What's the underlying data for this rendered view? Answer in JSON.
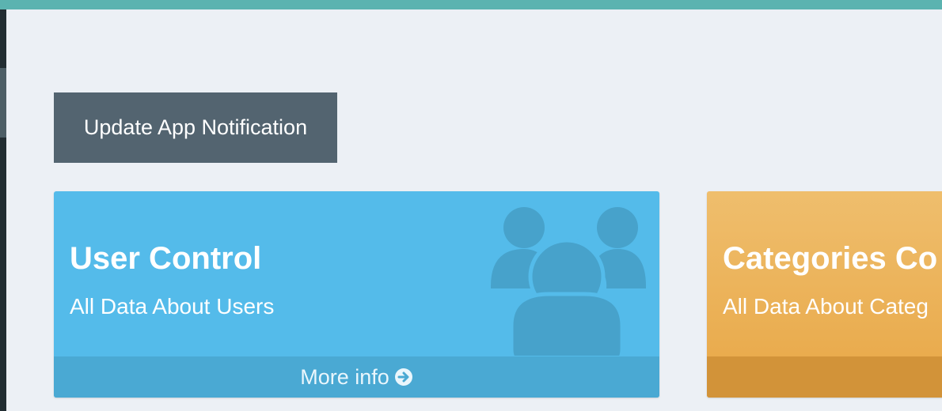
{
  "notification_button": {
    "label": "Update App Notification"
  },
  "cards": [
    {
      "title": "User Control",
      "subtitle": "All Data About Users",
      "footer_label": "More info",
      "footer_icon": "arrow-circle-right-icon",
      "background_icon": "users-icon",
      "color": "#54bbea"
    },
    {
      "title": "Categories Co",
      "subtitle": "All Data About Categ",
      "footer_label": "",
      "color": "#eab055"
    }
  ],
  "colors": {
    "top_bar": "#5bb3b0",
    "sidebar": "#222d32",
    "page_background": "#ecf0f5",
    "button_background": "#536470"
  }
}
